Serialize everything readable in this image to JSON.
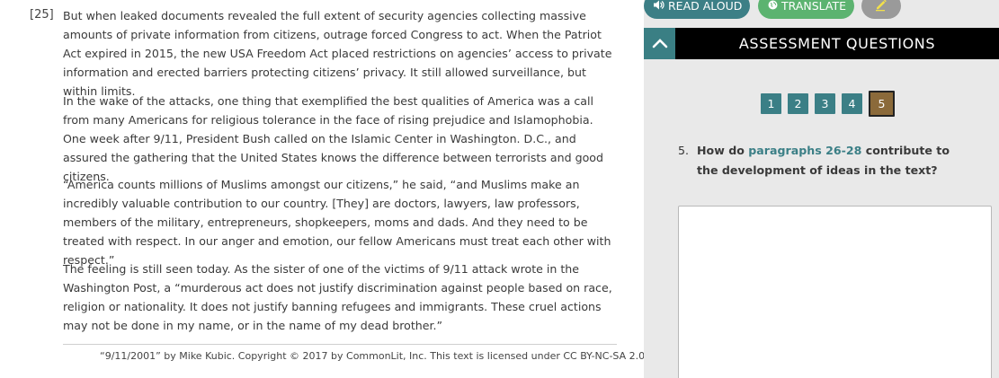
{
  "reading": {
    "paragraph_number": "[25]",
    "paragraphs": [
      "But when leaked documents revealed the full extent of security agencies collecting massive amounts of private information from citizens, outrage forced Congress to act. When the Patriot Act expired in 2015, the new USA Freedom Act placed restrictions on agencies’ access to private information and erected barriers protecting citizens’ privacy. It still allowed surveillance, but within limits.",
      "In the wake of the attacks, one thing that exemplified the best qualities of America was a call from many Americans for religious tolerance in the face of rising prejudice and Islamophobia. One week after 9/11, President Bush called on the Islamic Center in Washington. D.C., and assured the gathering that the United States knows the difference between terrorists and good citizens.",
      "“America counts millions of Muslims amongst our citizens,” he said, “and Muslims make an incredibly valuable contribution to our country. [They] are doctors, lawyers, law professors, members of the military, entrepreneurs, shopkeepers, moms and dads. And they need to be treated with respect. In our anger and emotion, our fellow Americans must treat each other with respect.”",
      "The feeling is still seen today. As the sister of one of the victims of 9/11 attack wrote in the Washington Post, a “murderous act does not justify discrimination against people based on race, religion or nationality. It does not justify banning refugees and immigrants. These cruel actions may not be done in my name, or in the name of my dead brother.”"
    ],
    "citation": "“9/11/2001” by Mike Kubic. Copyright © 2017 by CommonLit, Inc. This text is licensed under CC BY-NC-SA 2.0"
  },
  "toolbar": {
    "read_aloud": "READ ALOUD",
    "translate": "TRANSLATE",
    "read_aloud_icon": "speaker-icon",
    "translate_icon": "globe-icon",
    "highlight_icon": "pencil-icon"
  },
  "panel": {
    "title": "ASSESSMENT QUESTIONS",
    "collapse_icon": "chevron-up-icon",
    "questions": [
      "1",
      "2",
      "3",
      "4",
      "5"
    ],
    "active_question": "5"
  },
  "question": {
    "number": "5.",
    "prefix": "How do ",
    "link": "paragraphs 26-28",
    "suffix": " contribute to the development of ideas in the text?"
  },
  "answer": {
    "value": "",
    "placeholder": ""
  },
  "colors": {
    "teal": "#3b7f86",
    "green": "#5cb370",
    "active_question": "#8b6a3a",
    "panel_bg": "#e9e9e9",
    "header_bg": "#000000"
  }
}
